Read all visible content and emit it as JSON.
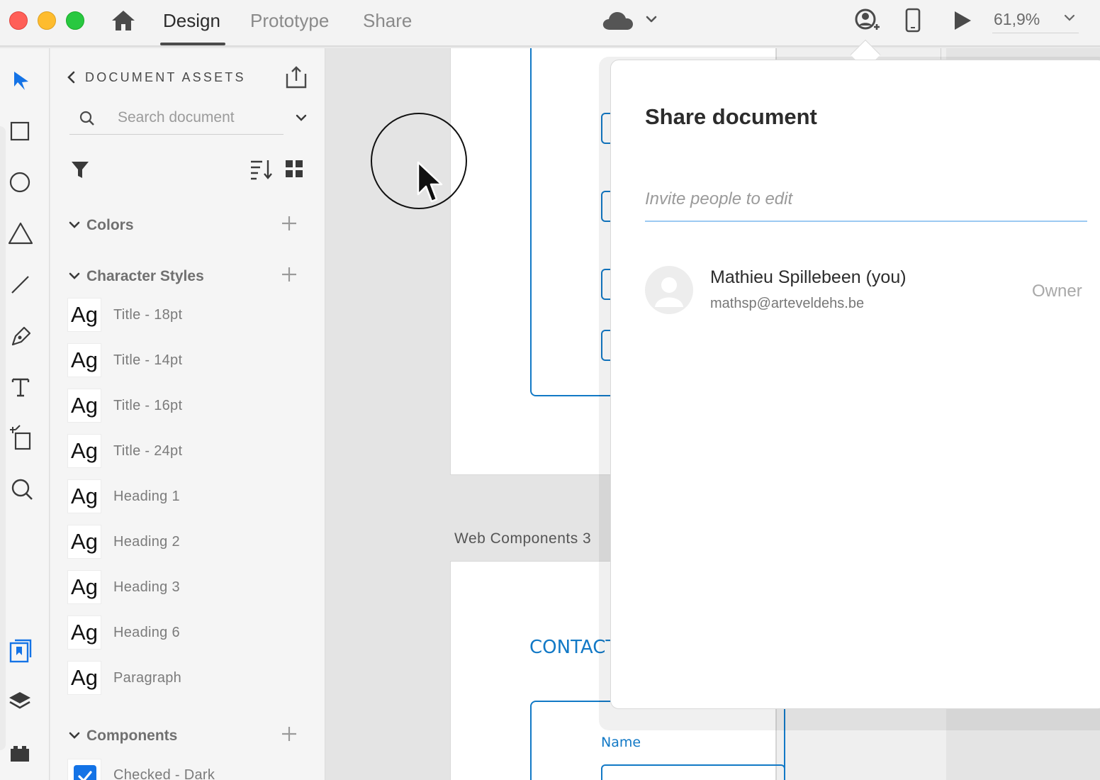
{
  "window": {
    "tabs": [
      {
        "label": "Design",
        "active": true
      },
      {
        "label": "Prototype",
        "active": false
      },
      {
        "label": "Share",
        "active": false
      }
    ],
    "zoom": "61,9%"
  },
  "icons": {
    "home": "home-icon",
    "cloud": "cloud-icon",
    "share_user": "user-plus-icon",
    "device": "mobile-device-icon",
    "play": "play-icon"
  },
  "tools": [
    "select-tool-icon",
    "rectangle-tool-icon",
    "ellipse-tool-icon",
    "polygon-tool-icon",
    "line-tool-icon",
    "pen-tool-icon",
    "text-tool-icon",
    "artboard-tool-icon",
    "zoom-tool-icon",
    "assets-icon",
    "layers-icon",
    "plugins-icon"
  ],
  "assets": {
    "title": "DOCUMENT ASSETS",
    "search_placeholder": "Search document",
    "sections": {
      "colors": "Colors",
      "character_styles": "Character Styles",
      "components": "Components"
    },
    "preview_glyph": "Ag",
    "character_styles": [
      "Title - 18pt",
      "Title - 14pt",
      "Title - 16pt",
      "Title - 24pt",
      "Heading 1",
      "Heading 2",
      "Heading 3",
      "Heading 6",
      "Paragraph"
    ],
    "components": [
      "Checked - Dark"
    ]
  },
  "canvas": {
    "artboard_label": "Web Components 3",
    "sketch_labels": {
      "contact": "CONTACT",
      "name": "Name"
    }
  },
  "share": {
    "title": "Share document",
    "invite_placeholder": "Invite people to edit",
    "people": [
      {
        "name": "Mathieu Spillebeen (you)",
        "email": "mathsp@arteveldehs.be",
        "role": "Owner"
      }
    ]
  },
  "colors": {
    "accent": "#1473e6",
    "sketch_blue": "#1279c6"
  }
}
